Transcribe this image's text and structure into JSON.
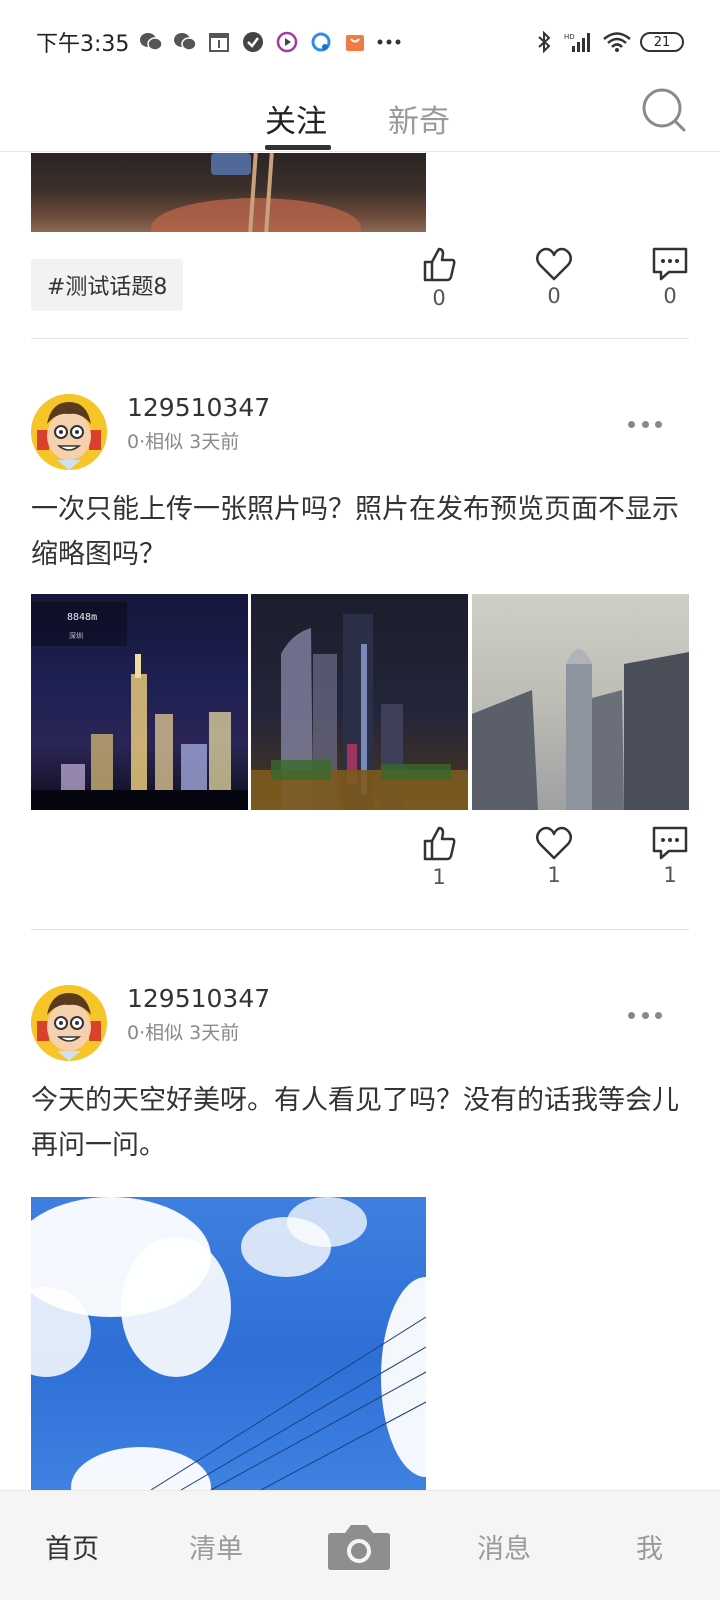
{
  "status_bar": {
    "time": "下午3:35",
    "battery": "21"
  },
  "top_nav": {
    "tabs": [
      {
        "label": "关注",
        "active": true
      },
      {
        "label": "新奇",
        "active": false
      }
    ]
  },
  "feed": {
    "previous_post": {
      "topic_tag": "#测试话题8",
      "likes": "0",
      "favorites": "0",
      "comments": "0"
    },
    "posts": [
      {
        "username": "129510347",
        "meta": "0·相似  3天前",
        "text": "一次只能上传一张照片吗？照片在发布预览页面不显示缩略图吗？",
        "likes": "1",
        "favorites": "1",
        "comments": "1"
      },
      {
        "username": "129510347",
        "meta": "0·相似  3天前",
        "text": "今天的天空好美呀。有人看见了吗？没有的话我等会儿再问一问。"
      }
    ]
  },
  "bottom_nav": {
    "items": [
      {
        "label": "首页",
        "active": true
      },
      {
        "label": "清单",
        "active": false
      },
      {
        "label": "消息",
        "active": false
      },
      {
        "label": "我",
        "active": false
      }
    ]
  },
  "icons": {
    "search": "search-icon",
    "like": "thumbs-up-icon",
    "favorite": "heart-icon",
    "comment": "comment-icon",
    "more": "more-icon",
    "camera": "camera-icon"
  },
  "colors": {
    "text_primary": "#333333",
    "text_secondary": "#8a8a8a",
    "tab_inactive": "#9a9a9a",
    "avatar_bg": "#f5c52a"
  }
}
